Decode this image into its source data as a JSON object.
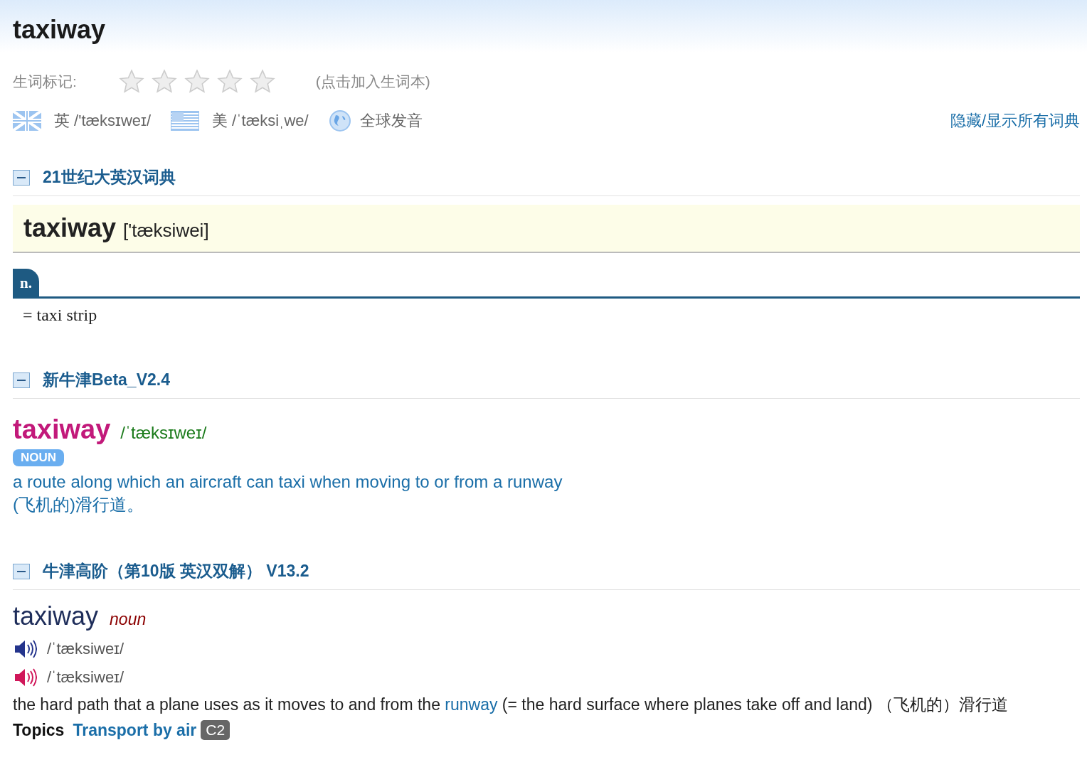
{
  "headword": "taxiway",
  "wordbook": {
    "label": "生词标记:",
    "stars": 0,
    "hint": "(点击加入生词本)"
  },
  "pronunciations": [
    {
      "kind": "uk",
      "label": "英 /'tæksɪweɪ/"
    },
    {
      "kind": "us",
      "label": "美 /ˈtæksiˌwe/"
    },
    {
      "kind": "global",
      "label": "全球发音"
    }
  ],
  "toggle_all": "隐藏/显示所有词典",
  "sections": [
    {
      "kind": "century",
      "title": "21世纪大英汉词典",
      "expanded": true,
      "word": "taxiway",
      "phonetic": "['tæksiwei]",
      "pos": "n.",
      "definition": "= taxi strip"
    },
    {
      "kind": "new-oxford",
      "title": "新牛津Beta_V2.4",
      "expanded": true,
      "word": "taxiway",
      "phonetic": "/ˈtæksɪweɪ/",
      "pos": "NOUN",
      "definition": "a route along which an aircraft can taxi when moving to or from a runway",
      "translation": "(飞机的)滑行道。"
    },
    {
      "kind": "oald",
      "title": "牛津高阶（第10版 英汉双解） V13.2",
      "expanded": true,
      "word": "taxiway",
      "pos": "noun",
      "audio": [
        {
          "kind": "uk",
          "phonetic": "/ˈtæksiweɪ/"
        },
        {
          "kind": "us",
          "phonetic": "/ˈtæksiweɪ/"
        }
      ],
      "definition_before": "the hard path that a plane uses as it moves to and from the",
      "definition_link": "runway",
      "definition_after": "(= the hard surface where planes take off and land)",
      "translation": "（飞机的）滑行道",
      "topics_label": "Topics",
      "topic": "Transport by air",
      "level": "C2"
    }
  ]
}
